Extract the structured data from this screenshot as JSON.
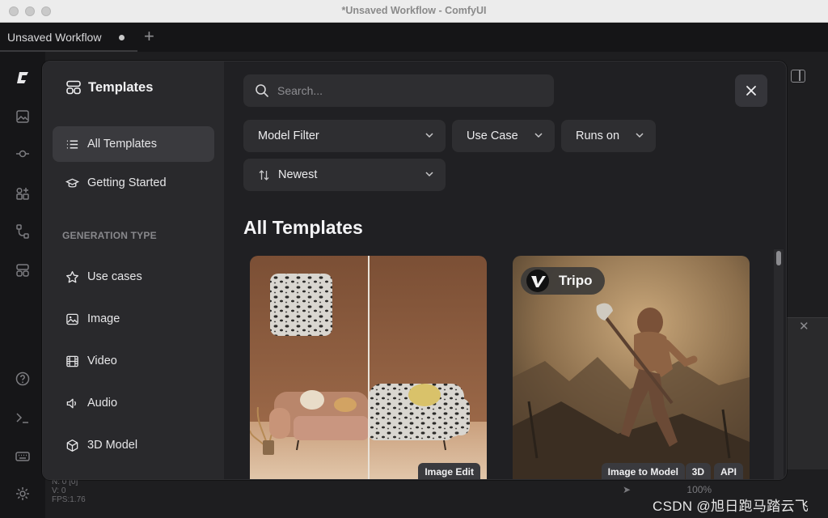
{
  "window": {
    "title": "*Unsaved Workflow - ComfyUI"
  },
  "tabs": [
    {
      "label": "Unsaved Workflow"
    }
  ],
  "status": {
    "line1": "N: 0 [0]",
    "line2": "V: 0",
    "line3": "FPS:1.76",
    "zoom": "100%"
  },
  "watermark": "CSDN @旭日跑马踏云飞",
  "templates_dialog": {
    "title": "Templates",
    "nav": [
      {
        "label": "All Templates",
        "icon": "list-icon",
        "active": true
      },
      {
        "label": "Getting Started",
        "icon": "graduation-cap-icon",
        "active": false
      }
    ],
    "generation_type_label": "GENERATION TYPE",
    "generation_types": [
      {
        "label": "Use cases",
        "icon": "star-icon"
      },
      {
        "label": "Image",
        "icon": "image-icon"
      },
      {
        "label": "Video",
        "icon": "film-icon"
      },
      {
        "label": "Audio",
        "icon": "speaker-icon"
      },
      {
        "label": "3D Model",
        "icon": "cube-icon"
      }
    ],
    "search_placeholder": "Search...",
    "filters": {
      "model_filter": "Model Filter",
      "use_case": "Use Case",
      "runs_on": "Runs on",
      "sort": "Newest"
    },
    "section_heading": "All Templates",
    "cards": [
      {
        "tags": [
          "Image Edit"
        ]
      },
      {
        "brand": "Tripo",
        "tags": [
          "Image to Model",
          "3D",
          "API"
        ]
      }
    ]
  }
}
